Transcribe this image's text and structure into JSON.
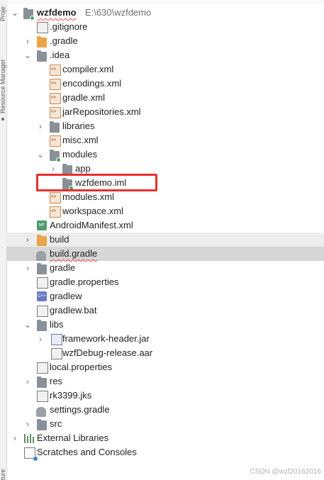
{
  "sidebar": {
    "project_tab": "Proje",
    "resource_manager_tab": "Resource Manager",
    "bottom_tab": "ture"
  },
  "tree": {
    "root": {
      "name": "wzfdemo",
      "path": "E:\\630\\wzfdemo"
    },
    "items": [
      ".gitignore",
      ".gradle",
      ".idea",
      "compiler.xml",
      "encodings.xml",
      "gradle.xml",
      "jarRepositories.xml",
      "libraries",
      "misc.xml",
      "modules",
      "app",
      "wzfdemo.iml",
      "modules.xml",
      "workspace.xml",
      "AndroidManifest.xml",
      "build",
      "build.gradle",
      "gradle",
      "gradle.properties",
      "gradlew",
      "gradlew.bat",
      "libs",
      "framework-header.jar",
      "wzfDebug-release.aar",
      "local.properties",
      "res",
      "rk3399.jks",
      "settings.gradle",
      "src",
      "External Libraries",
      "Scratches and Consoles"
    ]
  },
  "highlighted_item": "wzfdemo.iml",
  "colors": {
    "highlight_border": "#e8302e",
    "selection": "#d6d6d6",
    "folder_gray": "#8a9097",
    "folder_orange": "#e9a449"
  },
  "watermark": "CSDN @wzf20162016"
}
